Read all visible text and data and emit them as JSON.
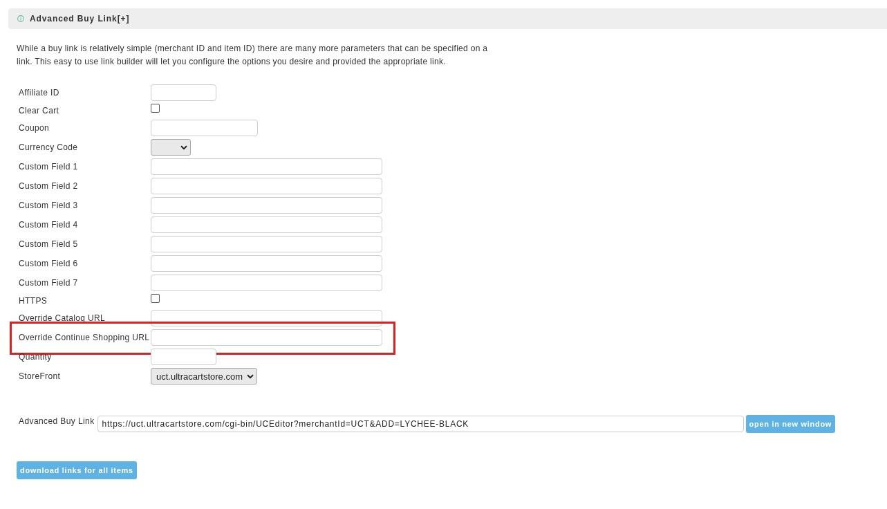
{
  "section": {
    "title": "Advanced Buy Link[+]",
    "description": "While a buy link is relatively simple (merchant ID and item ID) there are many more parameters that can be specified on a link. This easy to use link builder will let you configure the options you desire and provided the appropriate link."
  },
  "fields": [
    {
      "label": "Affiliate ID",
      "kind": "short",
      "highlighted": false
    },
    {
      "label": "Clear Cart",
      "kind": "checkbox",
      "checked": false,
      "highlighted": false
    },
    {
      "label": "Coupon",
      "kind": "medium",
      "highlighted": false
    },
    {
      "label": "Currency Code",
      "kind": "select",
      "highlighted": false
    },
    {
      "label": "Custom Field 1",
      "kind": "long",
      "highlighted": false
    },
    {
      "label": "Custom Field 2",
      "kind": "long",
      "highlighted": false
    },
    {
      "label": "Custom Field 3",
      "kind": "long",
      "highlighted": false
    },
    {
      "label": "Custom Field 4",
      "kind": "long",
      "highlighted": false
    },
    {
      "label": "Custom Field 5",
      "kind": "long",
      "highlighted": false
    },
    {
      "label": "Custom Field 6",
      "kind": "long",
      "highlighted": false
    },
    {
      "label": "Custom Field 7",
      "kind": "long",
      "highlighted": false
    },
    {
      "label": "HTTPS",
      "kind": "checkbox",
      "checked": false,
      "highlighted": false
    },
    {
      "label": "Override Catalog URL",
      "kind": "long",
      "highlighted": false
    },
    {
      "label": "Override Continue Shopping URL",
      "kind": "long",
      "highlighted": true
    },
    {
      "label": "Quantity",
      "kind": "short",
      "highlighted": false
    },
    {
      "label": "StoreFront",
      "kind": "select",
      "value": "uct.ultracartstore.com",
      "highlighted": false
    }
  ],
  "buy_link": {
    "label": "Advanced Buy Link",
    "value": "https://uct.ultracartstore.com/cgi-bin/UCEditor?merchantId=UCT&ADD=LYCHEE-BLACK",
    "button": "open in new window"
  },
  "download_button": "download links for all items"
}
